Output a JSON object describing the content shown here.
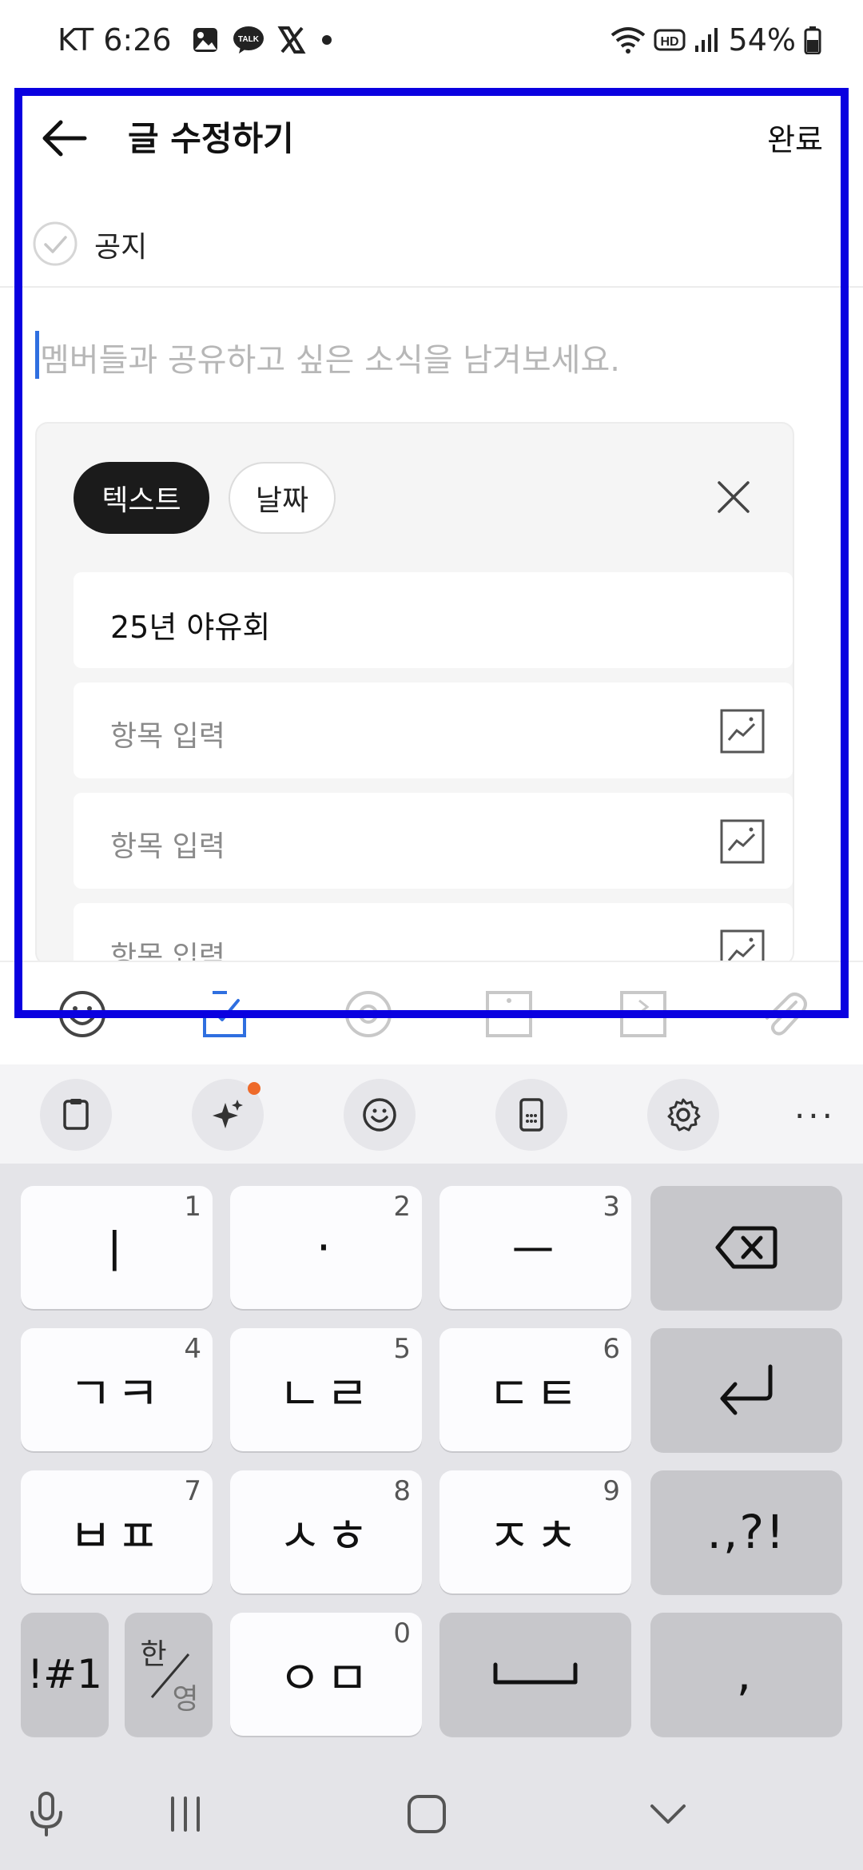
{
  "status_bar": {
    "carrier_time": "KT 6:26",
    "battery": "54%",
    "icons": [
      "gallery-icon",
      "kakaotalk-icon",
      "x-icon",
      "dot-icon",
      "wifi-icon",
      "hd-icon",
      "signal-icon",
      "battery-icon"
    ],
    "talk_badge": "TALK"
  },
  "header": {
    "title": "글 수정하기",
    "done_label": "완료"
  },
  "notice": {
    "label": "공지"
  },
  "editor": {
    "placeholder": "멤버들과 공유하고 싶은 소식을 남겨보세요."
  },
  "vote_card": {
    "tabs": [
      {
        "label": "텍스트",
        "selected": true
      },
      {
        "label": "날짜",
        "selected": false
      }
    ],
    "title_value": "25년 야유회",
    "items": [
      {
        "placeholder": "항목 입력"
      },
      {
        "placeholder": "항목 입력"
      },
      {
        "placeholder": "항목 입력"
      }
    ]
  },
  "toolbar": {
    "icons": [
      "emoji-icon",
      "vote-icon",
      "mention-icon",
      "image-icon",
      "video-icon",
      "attach-icon"
    ]
  },
  "keyboard": {
    "tools": [
      "clipboard-icon",
      "ai-sparkle-icon",
      "emoji-icon",
      "keypad-icon",
      "settings-icon"
    ],
    "more": "···",
    "rows": [
      [
        {
          "label": "ㅣ",
          "num": "1"
        },
        {
          "label": "·",
          "num": "2"
        },
        {
          "label": "ㅡ",
          "num": "3"
        },
        {
          "label": "",
          "num": "",
          "icon": "backspace-icon"
        }
      ],
      [
        {
          "label": "ㄱㅋ",
          "num": "4"
        },
        {
          "label": "ㄴㄹ",
          "num": "5"
        },
        {
          "label": "ㄷㅌ",
          "num": "6"
        },
        {
          "label": "",
          "num": "",
          "icon": "enter-icon"
        }
      ],
      [
        {
          "label": "ㅂㅍ",
          "num": "7"
        },
        {
          "label": "ㅅㅎ",
          "num": "8"
        },
        {
          "label": "ㅈㅊ",
          "num": "9"
        },
        {
          "label": ".,?!",
          "num": ""
        }
      ],
      [
        {
          "label": "!#1",
          "num": ""
        },
        {
          "label": "한/영",
          "num": "",
          "top": "한",
          "bottom": "영"
        },
        {
          "label": "ㅇㅁ",
          "num": "0"
        },
        {
          "label": "",
          "num": "",
          "icon": "space-icon"
        },
        {
          "label": ",",
          "num": ""
        }
      ]
    ]
  },
  "navbar": {
    "icons": [
      "mic-icon",
      "recent-apps-icon",
      "home-icon",
      "hide-keyboard-icon"
    ]
  }
}
